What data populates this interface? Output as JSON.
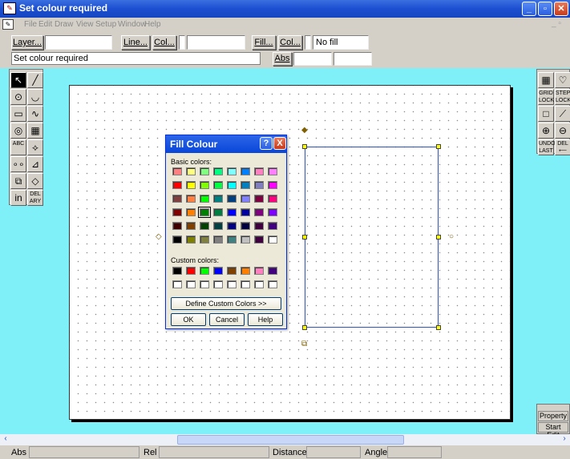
{
  "window": {
    "title": "Set colour required",
    "min": "_",
    "max": "▫",
    "close": "✕"
  },
  "menu": {
    "items": [
      "File",
      "Edit",
      "Draw",
      "View",
      "Setup",
      "Window",
      "Help"
    ],
    "right": "_ ▫"
  },
  "toolbar": {
    "layer_label": "Layer...",
    "line_label": "Line...",
    "col_label": "Col...",
    "fill_label": "Fill...",
    "fillcol_label": "Col...",
    "fill_value": "No fill",
    "abs_label": "Abs"
  },
  "status_top": "Set colour required",
  "left_tools": [
    [
      "↖",
      "╱"
    ],
    [
      "⊙",
      "◡"
    ],
    [
      "▭",
      "∿"
    ],
    [
      "◎",
      "▦"
    ],
    [
      "ABC",
      "⟡"
    ],
    [
      "∘∘",
      "⊿"
    ],
    [
      "⧉",
      "◇"
    ],
    [
      "in",
      "DEL ARY"
    ]
  ],
  "right_tools": [
    [
      "▦",
      "♡"
    ],
    [
      "GRID LOCK",
      "STEP LOCK"
    ],
    [
      "□",
      "⟋"
    ],
    [
      "⊕",
      "⊖"
    ],
    [
      "UNDO LAST",
      "DEL ⟵"
    ]
  ],
  "right_bottom": {
    "property": "Property",
    "start_edit": "Start Edit"
  },
  "dialog": {
    "title": "Fill Colour",
    "help": "?",
    "close": "X",
    "basic_label": "Basic colors:",
    "custom_label": "Custom colors:",
    "define": "Define Custom Colors >>",
    "ok": "OK",
    "cancel": "Cancel",
    "helpbtn": "Help",
    "basic_colors": [
      "#ff8080",
      "#ffff80",
      "#80ff80",
      "#00ff80",
      "#80ffff",
      "#0080ff",
      "#ff80c0",
      "#ff80ff",
      "#ff0000",
      "#ffff00",
      "#80ff00",
      "#00ff40",
      "#00ffff",
      "#0080c0",
      "#8080c0",
      "#ff00ff",
      "#804040",
      "#ff8040",
      "#00ff00",
      "#008080",
      "#004080",
      "#8080ff",
      "#800040",
      "#ff0080",
      "#800000",
      "#ff8000",
      "#008000",
      "#008040",
      "#0000ff",
      "#0000a0",
      "#800080",
      "#8000ff",
      "#400000",
      "#804000",
      "#004000",
      "#004040",
      "#000080",
      "#000040",
      "#400040",
      "#400080",
      "#000000",
      "#808000",
      "#808040",
      "#808080",
      "#408080",
      "#c0c0c0",
      "#400040",
      "#ffffff"
    ],
    "custom_colors": [
      "#000000",
      "#ff0000",
      "#00ff00",
      "#0000ff",
      "#804000",
      "#ff8000",
      "#ff80c0",
      "#400080",
      "#ffffff",
      "#ffffff",
      "#ffffff",
      "#ffffff",
      "#ffffff",
      "#ffffff",
      "#ffffff",
      "#ffffff"
    ],
    "selected_index": 26
  },
  "statusbar": {
    "abs": "Abs",
    "rel": "Rel",
    "distance": "Distance",
    "angle": "Angle"
  }
}
